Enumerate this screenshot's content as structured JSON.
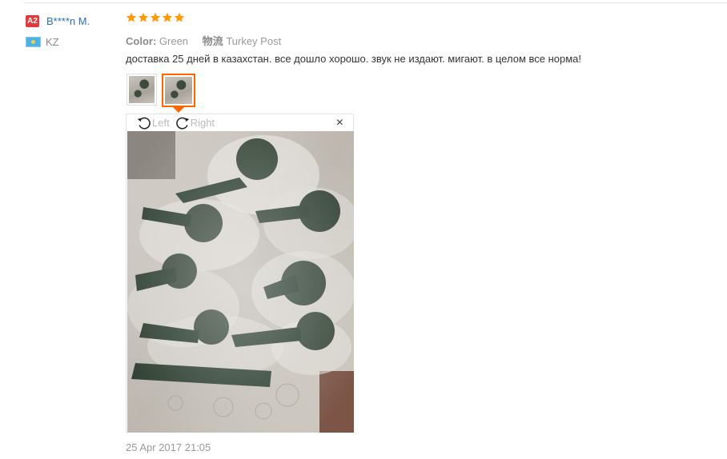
{
  "user": {
    "level_badge": "A2",
    "name": "B****n M.",
    "country": "KZ"
  },
  "review": {
    "rating": 5,
    "color_label": "Color:",
    "color_value": "Green",
    "shipping_label": "物流",
    "shipping_value": "Turkey Post",
    "text": "доставка 25 дней в казахстан. все дошло хорошо. звук не издают. мигают. в целом все норма!",
    "date": "25 Apr 2017 21:05"
  },
  "viewer": {
    "rotate_left_label": "Left",
    "rotate_right_label": "Right",
    "close_symbol": "×"
  },
  "icons": {
    "star": "star-icon",
    "flag": "kz-flag-icon",
    "rotate_left": "rotate-left-icon",
    "rotate_right": "rotate-right-icon",
    "close": "close-icon"
  },
  "colors": {
    "star": "#ff9900",
    "user_link": "#2a6ebb",
    "badge": "#e4393c",
    "active_thumb_border": "#ff6600"
  }
}
